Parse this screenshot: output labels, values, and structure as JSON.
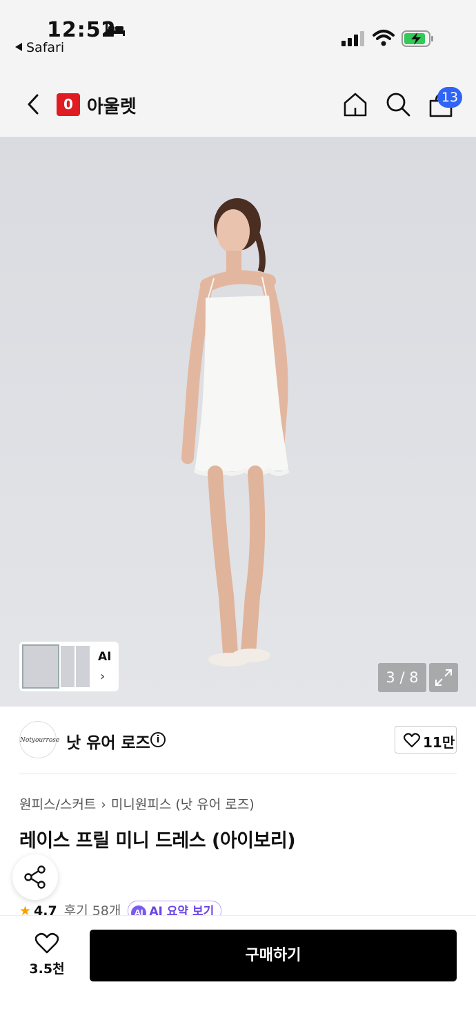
{
  "status_bar": {
    "time": "12:52",
    "back_app": "Safari",
    "icons": [
      "bed-icon",
      "signal-icon",
      "wifi-icon",
      "battery-charging-icon"
    ]
  },
  "nav": {
    "logo_letter": "0",
    "title": "아울렛",
    "cart_count": "13",
    "icons": [
      "back-chevron-icon",
      "home-icon",
      "search-icon",
      "cart-icon"
    ]
  },
  "gallery": {
    "ai_label": "AI",
    "counter": "3 / 8"
  },
  "brand": {
    "name": "낫 유어 로즈",
    "avatar_text": "Notyourrose",
    "like_count": "11만"
  },
  "product": {
    "breadcrumb": [
      "원피스/스커트",
      "미니원피스 (낫 유어 로즈)"
    ],
    "title": "레이스 프릴 미니 드레스 (아이보리)",
    "rating": "4.7",
    "reviews": "후기 58개",
    "ai_summary": "AI 요약 보기"
  },
  "bottom": {
    "wish_count": "3.5천",
    "buy_label": "구매하기"
  },
  "colors": {
    "brand_red": "#e11b22",
    "badge_blue": "#2f64f6",
    "star": "#f5a200",
    "ai_purple": "#6a45e8"
  }
}
